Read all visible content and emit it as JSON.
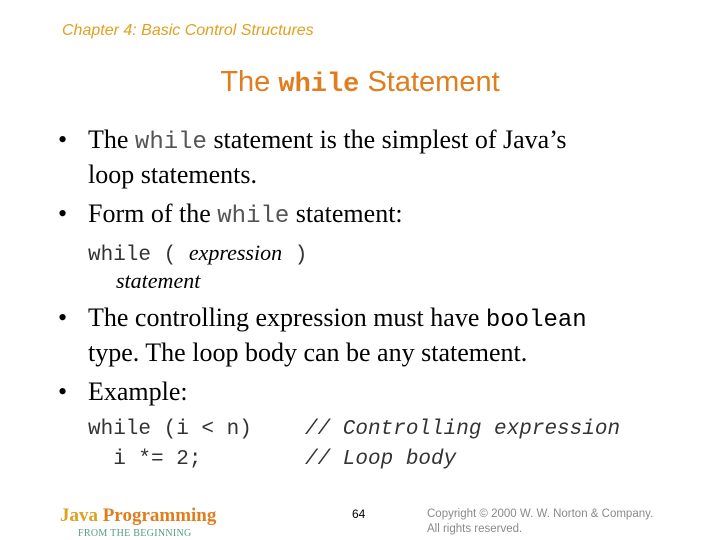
{
  "header": {
    "chapter": "Chapter 4: Basic Control Structures",
    "title_prefix": "The ",
    "title_code": "while",
    "title_suffix": " Statement"
  },
  "bullets": [
    {
      "line1_prefix": "The ",
      "line1_code": "while",
      "line1_suffix": " statement is the simplest of Java’s",
      "line2": "loop statements."
    },
    {
      "prefix": "Form of the ",
      "code": "while",
      "suffix": " statement:"
    },
    {
      "prefix": "The controlling expression must have ",
      "code": "boolean",
      "line2": "type. The loop body can be any statement."
    },
    {
      "text": "Example:"
    }
  ],
  "bullet_symbol": "•",
  "form": {
    "keyword": "while",
    "open": " ( ",
    "expression": "expression",
    "close": " )",
    "statement": "statement"
  },
  "example": {
    "line1_code": "while (i < n)",
    "line1_comment": "// Controlling expression",
    "line2_code": "  i *= 2;",
    "line2_comment": "// Loop body"
  },
  "footer": {
    "brand_java": "Java",
    "brand_programming": " Programming",
    "subtitle": "FROM THE BEGINNING",
    "page_number": "64",
    "copyright_line1": "Copyright © 2000 W. W. Norton & Company.",
    "copyright_line2": "All rights reserved."
  }
}
